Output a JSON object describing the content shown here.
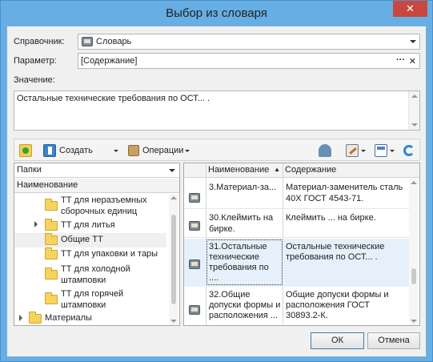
{
  "window": {
    "title": "Выбор из словаря",
    "close_glyph": "✕"
  },
  "form": {
    "directory_label": "Справочник:",
    "directory_value": "Словарь",
    "parameter_label": "Параметр:",
    "parameter_value": "[Содержание]",
    "parameter_dots": "···",
    "parameter_clear": "✕",
    "value_label": "Значение:",
    "value_text": "Остальные технические требования по ОСТ... ."
  },
  "toolbar": {
    "create_label": "Создать",
    "operations_label": "Операции"
  },
  "folders_panel": {
    "title": "Папки",
    "column_header": "Наименование",
    "items": [
      {
        "label_line1": "ТТ для неразъемных",
        "label_line2": "сборочных единиц"
      },
      {
        "label_line1": "ТТ для литья",
        "label_line2": ""
      },
      {
        "label_line1": "Общие ТТ",
        "label_line2": ""
      },
      {
        "label_line1": "ТТ для упаковки и тары",
        "label_line2": ""
      },
      {
        "label_line1": "ТТ для холодной",
        "label_line2": "штамповки"
      },
      {
        "label_line1": "ТТ для горячей",
        "label_line2": "штамповки"
      },
      {
        "label_line1": "Материалы",
        "label_line2": ""
      }
    ]
  },
  "records": {
    "col_name": "Наименование",
    "col_content": "Содержание",
    "sort_glyph": "▲",
    "rows": [
      {
        "name": "3.Материал-за...",
        "content_l1": "Материал-заменитель сталь",
        "content_l2": "40Х ГОСТ 4543-71."
      },
      {
        "name": "30.Клеймить на",
        "name_l2": "бирке.",
        "content_l1": "Клеймить ... на бирке.",
        "content_l2": ""
      },
      {
        "name": "31.Остальные",
        "name_l2": "технические",
        "name_l3": "требования по",
        "name_l4": "....",
        "content_l1": "Остальные технические",
        "content_l2": "требования по ОСТ... ."
      },
      {
        "name": "32.Общие",
        "name_l2": "допуски формы и",
        "name_l3": "расположения ...",
        "content_l1": "Общие допуски формы и",
        "content_l2": "расположения ГОСТ",
        "content_l3": "30893.2-К."
      }
    ]
  },
  "buttons": {
    "ok": "ОК",
    "cancel": "Отмена"
  }
}
